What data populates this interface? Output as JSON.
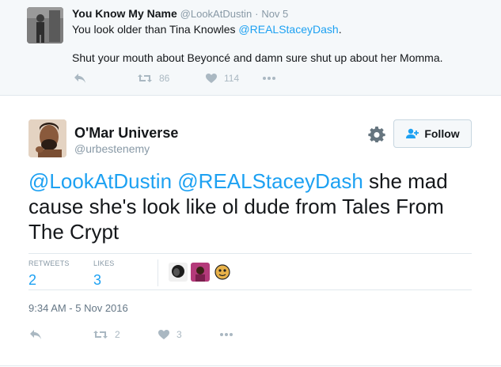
{
  "parent_tweet": {
    "name": "You Know My Name",
    "handle": "@LookAtDustin",
    "separator": "·",
    "date": "Nov 5",
    "line1_text": "You look older than Tina Knowles ",
    "line1_mention": "@REALStaceyDash",
    "line1_end": ".",
    "line2_text": "Shut your mouth about Beyoncé and damn sure shut up about her Momma.",
    "retweet_count": "86",
    "like_count": "114"
  },
  "main_tweet": {
    "name": "O'Mar Universe",
    "handle": "@urbestenemy",
    "follow_label": "Follow",
    "mention1": "@LookAtDustin",
    "mention2": "@REALStaceyDash",
    "text": " she mad cause she's look like ol dude from Tales From The Crypt",
    "stats": {
      "retweets_label": "RETWEETS",
      "retweets_count": "2",
      "likes_label": "LIKES",
      "likes_count": "3"
    },
    "timestamp": "9:34 AM - 5 Nov 2016",
    "retweet_count": "2",
    "like_count": "3"
  },
  "colors": {
    "link": "#1da1f2",
    "muted": "#8899a6",
    "action_icon": "#aab8c2",
    "parent_bg": "#f5f8fa"
  },
  "icons": [
    "reply-icon",
    "retweet-icon",
    "heart-icon",
    "more-icon",
    "gear-icon",
    "follow-user-icon"
  ]
}
